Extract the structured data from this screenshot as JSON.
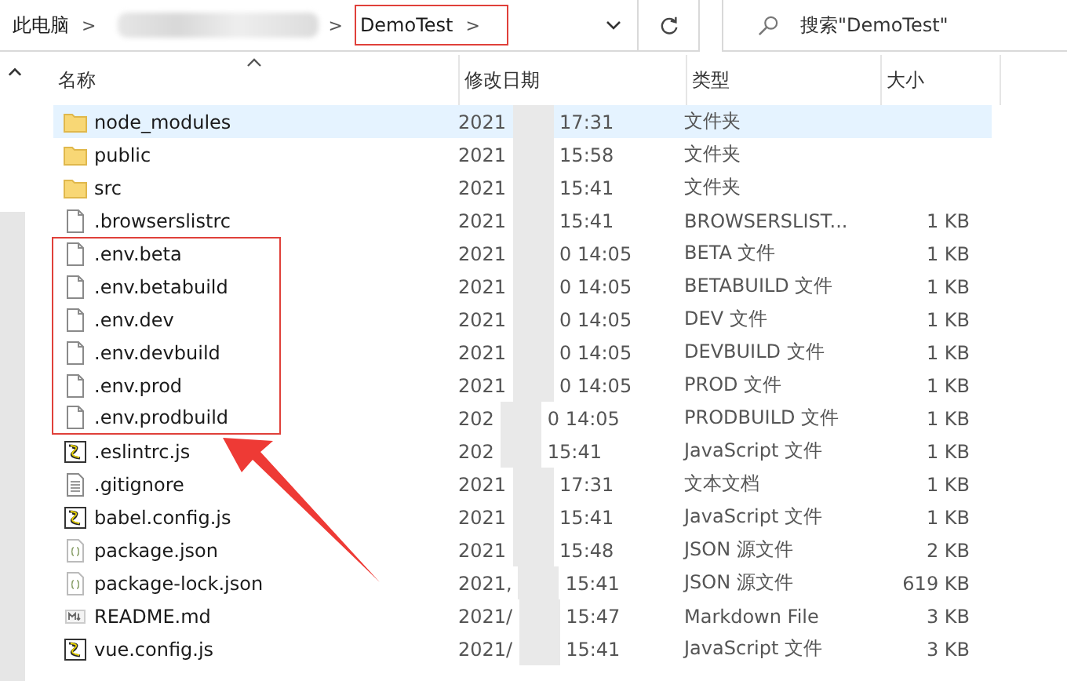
{
  "address_bar": {
    "crumbs": [
      {
        "kind": "text",
        "label": "此电脑",
        "highlighted": false
      },
      {
        "kind": "redacted"
      },
      {
        "kind": "text",
        "label": "DemoTest",
        "highlighted": true
      }
    ],
    "separator": ">"
  },
  "search": {
    "placeholder": "搜索\"DemoTest\""
  },
  "columns": [
    {
      "label": "名称",
      "sorted": true
    },
    {
      "label": "修改日期",
      "sorted": false
    },
    {
      "label": "类型",
      "sorted": false
    },
    {
      "label": "大小",
      "sorted": false
    }
  ],
  "rows": [
    {
      "name": "node_modules",
      "kind": "folder",
      "date_start": "2021",
      "date_end": "17:31",
      "type": "文件夹",
      "selected": true,
      "highlighted": false
    },
    {
      "name": "public",
      "kind": "folder",
      "date_start": "2021",
      "date_end": "15:58",
      "type": "文件夹",
      "selected": false,
      "highlighted": false
    },
    {
      "name": "src",
      "kind": "folder",
      "date_start": "2021",
      "date_end": "15:41",
      "type": "文件夹",
      "selected": false,
      "highlighted": false
    },
    {
      "name": ".browserslistrc",
      "kind": "file",
      "date_start": "2021",
      "date_end": "15:41",
      "type": "BROWSERSLIST...",
      "size": "1 KB",
      "selected": false,
      "highlighted": false
    },
    {
      "name": ".env.beta",
      "kind": "file",
      "date_start": "2021",
      "date_end": "0 14:05",
      "type": "BETA 文件",
      "size": "1 KB",
      "selected": false,
      "highlighted": true
    },
    {
      "name": ".env.betabuild",
      "kind": "file",
      "date_start": "2021",
      "date_end": "0 14:05",
      "type": "BETABUILD 文件",
      "size": "1 KB",
      "selected": false,
      "highlighted": true
    },
    {
      "name": ".env.dev",
      "kind": "file",
      "date_start": "2021",
      "date_end": "0 14:05",
      "type": "DEV 文件",
      "size": "1 KB",
      "selected": false,
      "highlighted": true
    },
    {
      "name": ".env.devbuild",
      "kind": "file",
      "date_start": "2021",
      "date_end": "0 14:05",
      "type": "DEVBUILD 文件",
      "size": "1 KB",
      "selected": false,
      "highlighted": true
    },
    {
      "name": ".env.prod",
      "kind": "file",
      "date_start": "2021",
      "date_end": "0 14:05",
      "type": "PROD 文件",
      "size": "1 KB",
      "selected": false,
      "highlighted": true
    },
    {
      "name": ".env.prodbuild",
      "kind": "file",
      "date_start": "202",
      "date_end": "0 14:05",
      "type": "PRODBUILD 文件",
      "size": "1 KB",
      "selected": false,
      "highlighted": true
    },
    {
      "name": ".eslintrc.js",
      "kind": "script",
      "date_start": "202",
      "date_end": "15:41",
      "type": "JavaScript 文件",
      "size": "1 KB",
      "selected": false,
      "highlighted": false
    },
    {
      "name": ".gitignore",
      "kind": "text",
      "date_start": "2021",
      "date_end": "17:31",
      "type": "文本文档",
      "size": "1 KB",
      "selected": false,
      "highlighted": false
    },
    {
      "name": "babel.config.js",
      "kind": "script",
      "date_start": "2021",
      "date_end": "15:41",
      "type": "JavaScript 文件",
      "size": "1 KB",
      "selected": false,
      "highlighted": false
    },
    {
      "name": "package.json",
      "kind": "json",
      "date_start": "2021",
      "date_end": "15:48",
      "type": "JSON 源文件",
      "size": "2 KB",
      "selected": false,
      "highlighted": false
    },
    {
      "name": "package-lock.json",
      "kind": "json",
      "date_start": "2021,",
      "date_end": "15:41",
      "type": "JSON 源文件",
      "size": "619 KB",
      "selected": false,
      "highlighted": false
    },
    {
      "name": "README.md",
      "kind": "markdown",
      "date_start": "2021/",
      "date_end": "15:47",
      "type": "Markdown File",
      "size": "3 KB",
      "selected": false,
      "highlighted": false
    },
    {
      "name": "vue.config.js",
      "kind": "script",
      "date_start": "2021/",
      "date_end": "15:41",
      "type": "JavaScript 文件",
      "size": "3 KB",
      "selected": false,
      "highlighted": false
    }
  ],
  "annotation_arrow": true
}
